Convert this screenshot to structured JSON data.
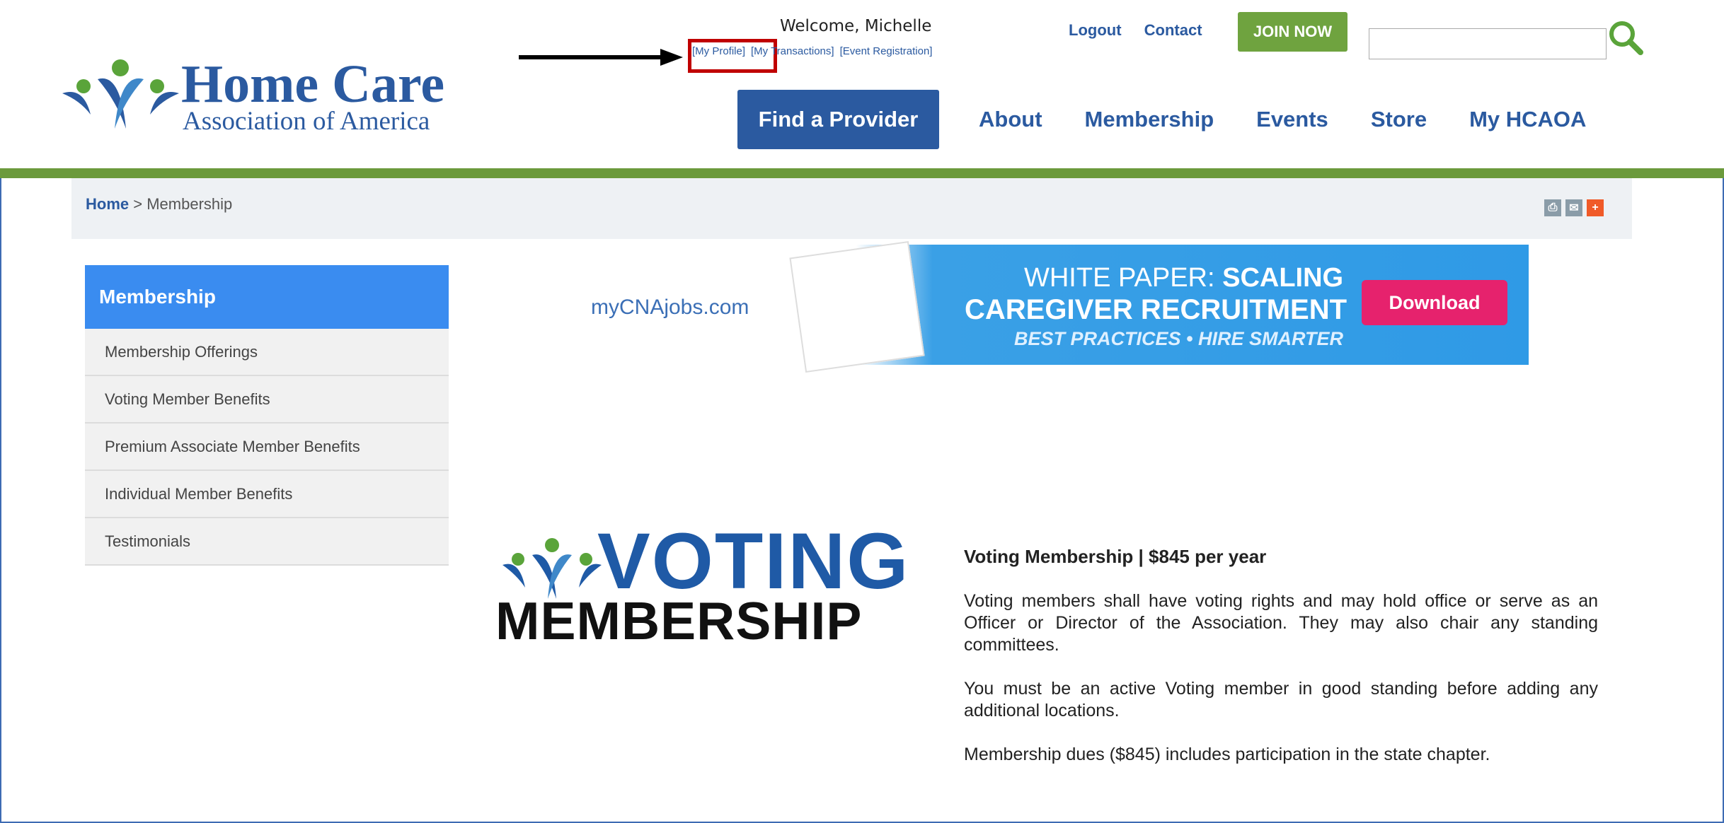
{
  "header": {
    "logo_title": "Home Care",
    "logo_subtitle": "Association of America",
    "welcome": "Welcome, Michelle",
    "user_links": [
      "[My Profile]",
      "[My Transactions]",
      "[Event Registration]"
    ],
    "logout": "Logout",
    "contact": "Contact",
    "join_now": "JOIN NOW",
    "search_placeholder": ""
  },
  "nav": {
    "find_provider": "Find a Provider",
    "items": [
      "About",
      "Membership",
      "Events",
      "Store",
      "My HCAOA"
    ]
  },
  "breadcrumb": {
    "home": "Home",
    "separator": ">",
    "current": "Membership"
  },
  "sidebar": {
    "title": "Membership",
    "items": [
      "Membership Offerings",
      "Voting Member Benefits",
      "Premium Associate Member Benefits",
      "Individual Member Benefits",
      "Testimonials"
    ]
  },
  "banner": {
    "brand": "myCNAjobs.com",
    "line1_a": "WHITE PAPER: ",
    "line1_b": "SCALING",
    "line2": "CAREGIVER RECRUITMENT",
    "line3": "BEST PRACTICES • HIRE SMARTER",
    "download": "Download"
  },
  "vote_logo": {
    "voting": "VOTING",
    "membership": "MEMBERSHIP"
  },
  "content": {
    "heading": "Voting Membership | $845 per year",
    "paragraphs": [
      "Voting members shall have voting rights and may hold office or serve as an Officer or Director of the Association. They may also chair any standing committees.",
      "You must be an active Voting member in good standing before adding any additional locations.",
      "Membership dues ($845) includes participation in the state chapter."
    ]
  },
  "colors": {
    "brand_blue": "#2b5aa0",
    "accent_green": "#6fa33f",
    "sidebar_blue": "#3a8cf0",
    "download_pink": "#e6226d",
    "highlight_red": "#c00000"
  }
}
